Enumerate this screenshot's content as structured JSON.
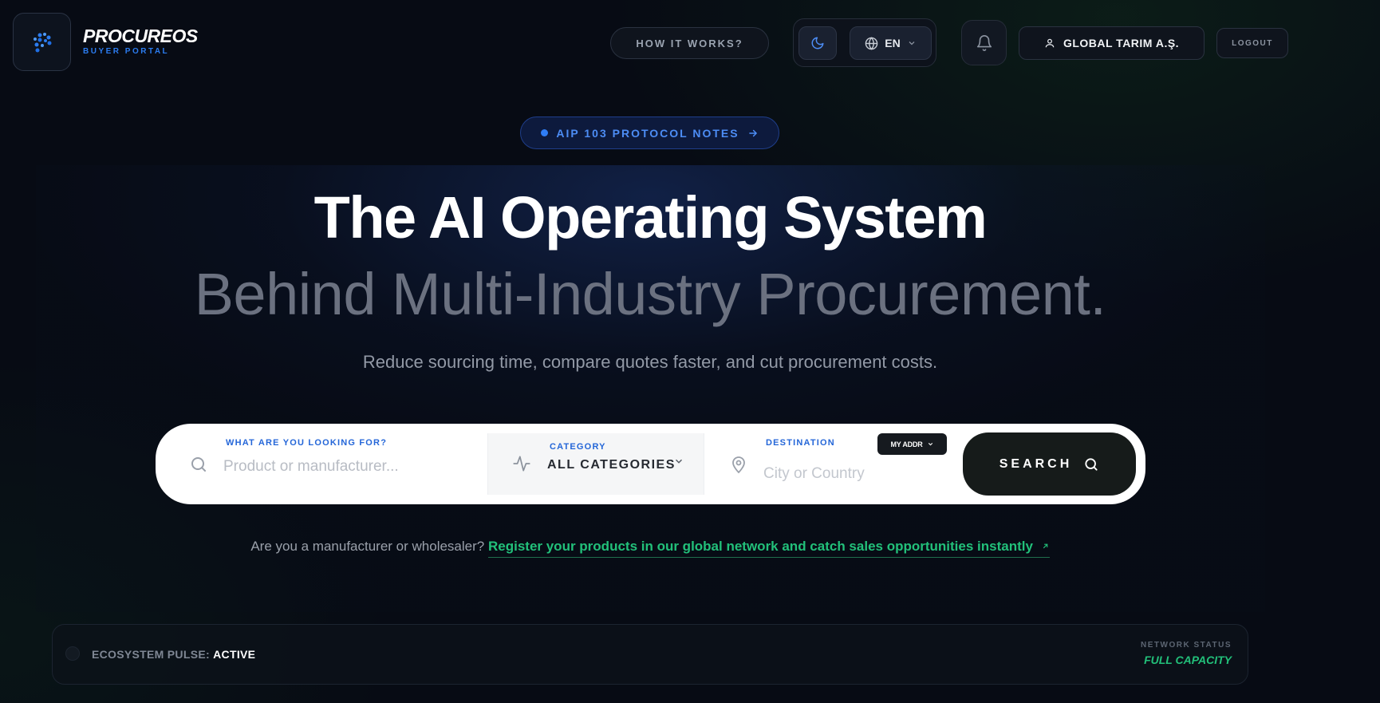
{
  "brand": {
    "name": "PROCUREOS",
    "subtitle": "BUYER PORTAL"
  },
  "header": {
    "how_it_works": "HOW IT WORKS?",
    "language": "EN",
    "user_name": "GLOBAL TARIM A.Ş.",
    "logout": "LOGOUT"
  },
  "protocol_badge": {
    "label": "AIP 103 PROTOCOL NOTES"
  },
  "hero": {
    "title": "The AI Operating System",
    "subtitle": "Behind Multi-Industry Procurement.",
    "tagline": "Reduce sourcing time, compare quotes faster, and cut procurement costs."
  },
  "search": {
    "query_label": "WHAT ARE YOU LOOKING FOR?",
    "query_placeholder": "Product or manufacturer...",
    "category_label": "CATEGORY",
    "category_value": "ALL CATEGORIES",
    "destination_label": "DESTINATION",
    "destination_placeholder": "City or Country",
    "my_address": "MY ADDR",
    "button": "SEARCH"
  },
  "register": {
    "prompt": "Are you a manufacturer or wholesaler?",
    "link": "Register your products in our global network and catch sales opportunities instantly"
  },
  "pulse": {
    "label": "ECOSYSTEM PULSE:",
    "status": "ACTIVE",
    "network_label": "NETWORK STATUS",
    "network_value": "FULL CAPACITY"
  },
  "colors": {
    "accent_blue": "#2b7cf0",
    "accent_green": "#22c07a",
    "background": "#070b14"
  }
}
